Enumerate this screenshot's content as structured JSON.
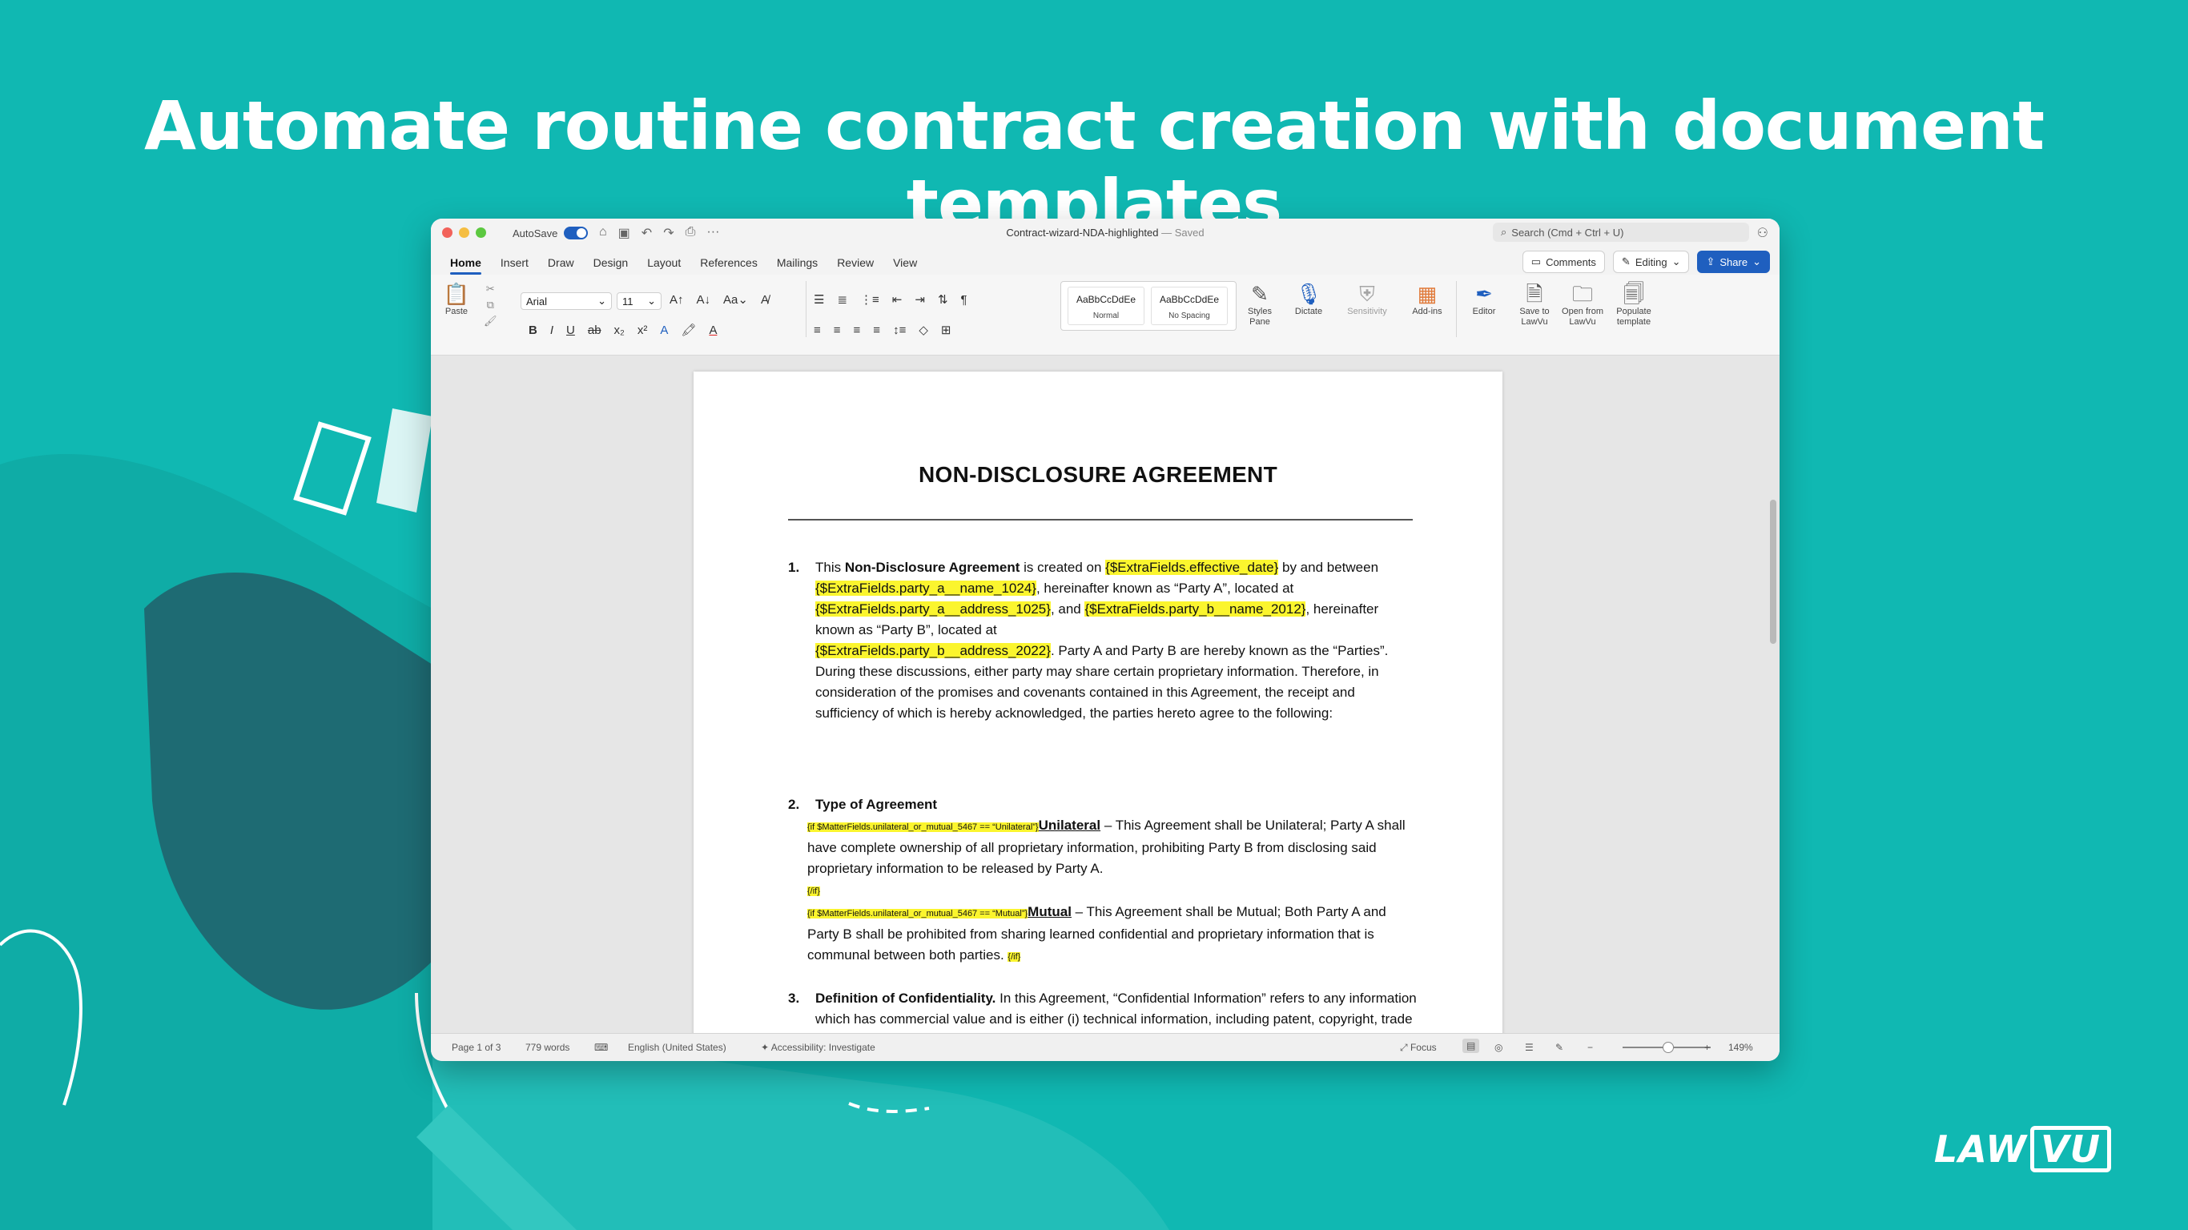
{
  "headline": "Automate routine contract creation with document templates",
  "brand": {
    "left": "LAW",
    "right": "VU"
  },
  "window": {
    "autosave_label": "AutoSave",
    "doc_title": "Contract-wizard-NDA-highlighted",
    "saved_state": "— Saved",
    "search_placeholder": "Search (Cmd + Ctrl + U)"
  },
  "tabs": [
    "Home",
    "Insert",
    "Draw",
    "Design",
    "Layout",
    "References",
    "Mailings",
    "Review",
    "View"
  ],
  "tab_right": {
    "comments": "Comments",
    "editing": "Editing",
    "share": "Share"
  },
  "ribbon": {
    "paste": "Paste",
    "font_name": "Arial",
    "font_size": "11",
    "style1_preview": "AaBbCcDdEe",
    "style1_name": "Normal",
    "style2_preview": "AaBbCcDdEe",
    "style2_name": "No Spacing",
    "styles_pane": [
      "Styles",
      "Pane"
    ],
    "dictate": "Dictate",
    "sensitivity": "Sensitivity",
    "addins": "Add-ins",
    "editor": "Editor",
    "save_lawvu": [
      "Save to",
      "LawVu"
    ],
    "open_lawvu": [
      "Open from",
      "LawVu"
    ],
    "populate": [
      "Populate",
      "template"
    ]
  },
  "document": {
    "heading": "NON-DISCLOSURE AGREEMENT",
    "s1_num": "1.",
    "s1": {
      "p1": "This ",
      "b1": "Non-Disclosure Agreement",
      "p2": " is created on ",
      "f1": "{$ExtraFields.effective_date}",
      "p3": " by and between",
      "f2": "{$ExtraFields.party_a__name_1024}",
      "p4": ", hereinafter known as “Party A”, located at",
      "f3": "{$ExtraFields.party_a__address_1025}",
      "p5": ", and ",
      "f4": "{$ExtraFields.party_b__name_2012}",
      "p6": ", hereinafter known as “Party B”, located at",
      "f5": "{$ExtraFields.party_b__address_2022}",
      "p7": ". Party A and Party B are hereby known as the “Parties”. During these discussions, either party may share certain proprietary information. Therefore, in consideration of the promises and covenants contained in this Agreement, the receipt and sufficiency of which is hereby acknowledged, the parties hereto agree to the following:"
    },
    "s2_num": "2.",
    "s2_title": "Type of Agreement",
    "s2": {
      "if1": "{if $MatterFields.unilateral_or_mutual_5467 == “Unilateral”}",
      "u1": "Unilateral",
      "t1": " – This Agreement shall be Unilateral; Party A shall have complete ownership of all proprietary information, prohibiting Party B from disclosing said proprietary information to be released by Party A.",
      "endif1": "{/if}",
      "if2": "{if $MatterFields.unilateral_or_mutual_5467 == “Mutual”}",
      "u2": "Mutual",
      "t2": " – This Agreement shall be Mutual; Both Party A and Party B shall be prohibited from sharing learned confidential and proprietary information that is communal between both parties. ",
      "endif2": "{/if}"
    },
    "s3_num": "3.",
    "s3_title": "Definition of Confidentiality.",
    "s3_text": " In this Agreement, “Confidential Information” refers to any information which has commercial value and is either (i) technical information, including patent, copyright, trade secret, and other proprietary information, techniques, sketches,"
  },
  "status": {
    "page": "Page 1 of 3",
    "words": "779 words",
    "language": "English (United States)",
    "accessibility": "Accessibility: Investigate",
    "focus": "Focus",
    "zoom": "149%"
  },
  "colors": {
    "background": "#10b8b2",
    "accent": "#1f5fbf",
    "highlight": "#fbf52e"
  }
}
